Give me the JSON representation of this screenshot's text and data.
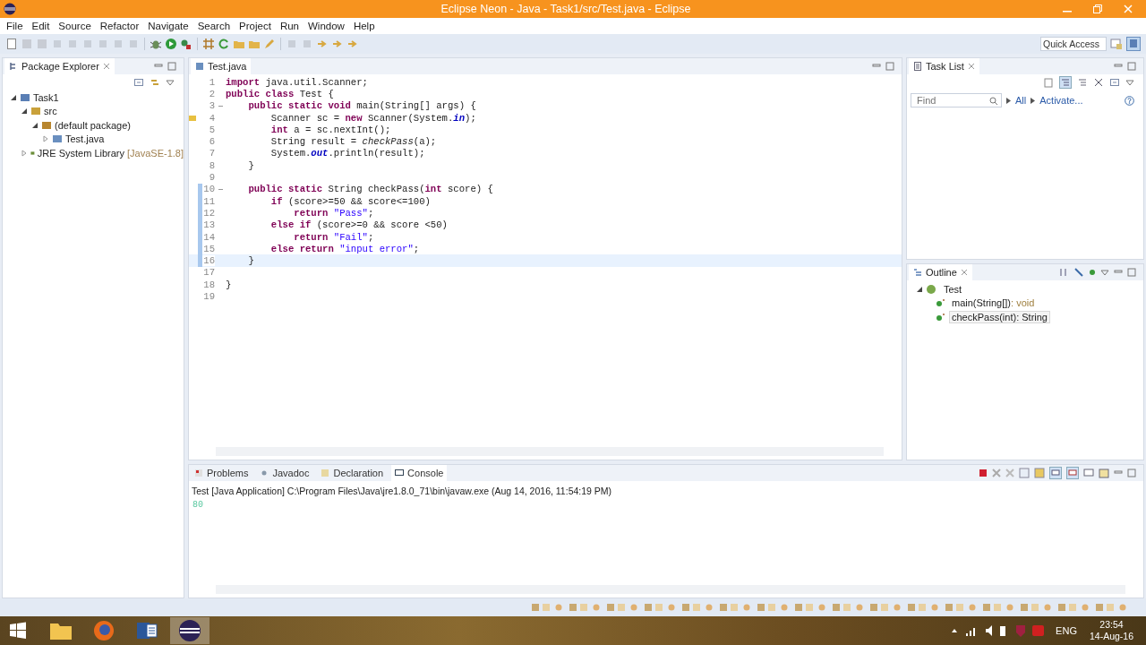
{
  "window": {
    "title": "Eclipse Neon - Java - Task1/src/Test.java - Eclipse"
  },
  "menu": [
    "File",
    "Edit",
    "Source",
    "Refactor",
    "Navigate",
    "Search",
    "Project",
    "Run",
    "Window",
    "Help"
  ],
  "quick_access": {
    "placeholder": "Quick Access"
  },
  "package_explorer": {
    "title": "Package Explorer",
    "tree": [
      {
        "label": "Task1",
        "kind": "project",
        "expanded": true,
        "children": [
          {
            "label": "src",
            "kind": "folder",
            "expanded": true,
            "children": [
              {
                "label": "(default package)",
                "kind": "package",
                "expanded": true,
                "children": [
                  {
                    "label": "Test.java",
                    "kind": "file",
                    "expanded": false
                  }
                ]
              }
            ]
          },
          {
            "label": "JRE System Library",
            "decoration": "[JavaSE-1.8]",
            "kind": "library",
            "expanded": false
          }
        ]
      }
    ]
  },
  "editor": {
    "tabs": [
      {
        "label": "Test.java",
        "selected": true
      }
    ],
    "lines": [
      {
        "number": "1",
        "fold": false,
        "warning": false,
        "changed": false,
        "current": false,
        "tokens": [
          {
            "kind": "keyword",
            "text": "import"
          },
          {
            "kind": "text",
            "text": " java.util.Scanner;"
          }
        ]
      },
      {
        "number": "2",
        "fold": false,
        "warning": false,
        "changed": false,
        "current": false,
        "tokens": [
          {
            "kind": "keyword",
            "text": "public class"
          },
          {
            "kind": "text",
            "text": " Test {"
          }
        ]
      },
      {
        "number": "3",
        "fold": true,
        "warning": false,
        "changed": false,
        "current": false,
        "tokens": [
          {
            "kind": "keyword",
            "text": "    public static void"
          },
          {
            "kind": "text",
            "text": " main(String[] args) {"
          }
        ]
      },
      {
        "number": "4",
        "fold": false,
        "warning": true,
        "changed": false,
        "current": false,
        "tokens": [
          {
            "kind": "text",
            "text": "        Scanner sc = "
          },
          {
            "kind": "keyword",
            "text": "new"
          },
          {
            "kind": "text",
            "text": " Scanner(System."
          },
          {
            "kind": "field",
            "text": "in"
          },
          {
            "kind": "text",
            "text": ");"
          }
        ]
      },
      {
        "number": "5",
        "fold": false,
        "warning": false,
        "changed": false,
        "current": false,
        "tokens": [
          {
            "kind": "keyword",
            "text": "        int"
          },
          {
            "kind": "text",
            "text": " a = sc.nextInt();"
          }
        ]
      },
      {
        "number": "6",
        "fold": false,
        "warning": false,
        "changed": false,
        "current": false,
        "tokens": [
          {
            "kind": "text",
            "text": "        String result = "
          },
          {
            "kind": "method",
            "text": "checkPass"
          },
          {
            "kind": "text",
            "text": "(a);"
          }
        ]
      },
      {
        "number": "7",
        "fold": false,
        "warning": false,
        "changed": false,
        "current": false,
        "tokens": [
          {
            "kind": "text",
            "text": "        System."
          },
          {
            "kind": "field",
            "text": "out"
          },
          {
            "kind": "text",
            "text": ".println(result);"
          }
        ]
      },
      {
        "number": "8",
        "fold": false,
        "warning": false,
        "changed": false,
        "current": false,
        "tokens": [
          {
            "kind": "text",
            "text": "    }"
          }
        ]
      },
      {
        "number": "9",
        "fold": false,
        "warning": false,
        "changed": false,
        "current": false
      },
      {
        "number": "10",
        "fold": true,
        "warning": false,
        "changed": true,
        "current": false,
        "tokens": [
          {
            "kind": "keyword",
            "text": "    public static"
          },
          {
            "kind": "text",
            "text": " String checkPass("
          },
          {
            "kind": "keyword",
            "text": "int"
          },
          {
            "kind": "text",
            "text": " score) {"
          }
        ]
      },
      {
        "number": "11",
        "fold": false,
        "warning": false,
        "changed": true,
        "current": false,
        "tokens": [
          {
            "kind": "keyword",
            "text": "        if"
          },
          {
            "kind": "text",
            "text": " (score>=50 && score<=100)"
          }
        ]
      },
      {
        "number": "12",
        "fold": false,
        "warning": false,
        "changed": true,
        "current": false,
        "tokens": [
          {
            "kind": "keyword",
            "text": "            return "
          },
          {
            "kind": "string",
            "text": "\"Pass\""
          },
          {
            "kind": "text",
            "text": ";"
          }
        ]
      },
      {
        "number": "13",
        "fold": false,
        "warning": false,
        "changed": true,
        "current": false,
        "tokens": [
          {
            "kind": "keyword",
            "text": "        else if"
          },
          {
            "kind": "text",
            "text": " (score>=0 && score <50)"
          }
        ]
      },
      {
        "number": "14",
        "fold": false,
        "warning": false,
        "changed": true,
        "current": false,
        "tokens": [
          {
            "kind": "keyword",
            "text": "            return "
          },
          {
            "kind": "string",
            "text": "\"Fail\""
          },
          {
            "kind": "text",
            "text": ";"
          }
        ]
      },
      {
        "number": "15",
        "fold": false,
        "warning": false,
        "changed": true,
        "current": false,
        "tokens": [
          {
            "kind": "keyword",
            "text": "        else return "
          },
          {
            "kind": "string",
            "text": "\"input error\""
          },
          {
            "kind": "text",
            "text": ";"
          }
        ]
      },
      {
        "number": "16",
        "fold": false,
        "warning": false,
        "changed": true,
        "current": true,
        "tokens": [
          {
            "kind": "text",
            "text": "    }"
          }
        ]
      },
      {
        "number": "17",
        "fold": false,
        "warning": false,
        "changed": false,
        "current": false
      },
      {
        "number": "18",
        "fold": false,
        "warning": false,
        "changed": false,
        "current": false,
        "tokens": [
          {
            "kind": "text",
            "text": "}"
          }
        ]
      },
      {
        "number": "19",
        "fold": false,
        "warning": false,
        "changed": false,
        "current": false
      }
    ]
  },
  "task_list": {
    "title": "Task List",
    "find": {
      "placeholder": "Find"
    },
    "links": [
      "All",
      "Activate..."
    ]
  },
  "outline": {
    "title": "Outline",
    "tree": [
      {
        "label": "Test",
        "kind": "class",
        "expanded": true,
        "selected": false,
        "children": [
          {
            "label": "main(String[])",
            "type": ": void",
            "kind": "method",
            "selected": false
          },
          {
            "label": "checkPass(int)",
            "type": ": String",
            "kind": "method",
            "selected": true
          }
        ]
      }
    ]
  },
  "console": {
    "tabs": [
      {
        "label": "Problems",
        "kind": "problems",
        "selected": false
      },
      {
        "label": "Javadoc",
        "kind": "javadoc",
        "selected": false
      },
      {
        "label": "Declaration",
        "kind": "declaration",
        "selected": false
      },
      {
        "label": "Console",
        "kind": "console",
        "selected": true
      }
    ],
    "launch": "Test [Java Application] C:\\Program Files\\Java\\jre1.8.0_71\\bin\\javaw.exe (Aug 14, 2016, 11:54:19 PM)",
    "output": [
      "80"
    ]
  },
  "taskbar": {
    "apps": [
      {
        "kind": "explorer",
        "selected": false
      },
      {
        "kind": "browser",
        "selected": false
      },
      {
        "kind": "word",
        "selected": false
      },
      {
        "kind": "eclipse",
        "selected": true
      }
    ],
    "language": "ENG",
    "time": "23:54",
    "date": "14-Aug-16"
  }
}
